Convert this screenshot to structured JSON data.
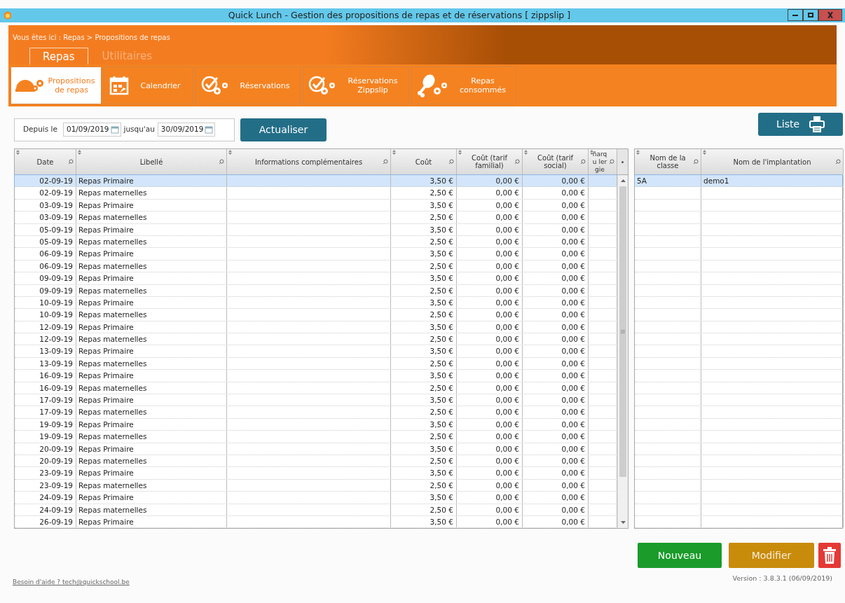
{
  "window": {
    "title": "Quick Lunch - Gestion des propositions de repas et de réservations [ zippslip ]"
  },
  "breadcrumb": "Vous êtes ici :  Repas > Propositions de repas",
  "tabs": [
    {
      "label": "Repas",
      "selected": true
    },
    {
      "label": "Utilitaires",
      "selected": false
    }
  ],
  "toolbar": [
    {
      "label": "Propositions de repas",
      "selected": true
    },
    {
      "label": "Calendrier",
      "selected": false
    },
    {
      "label": "Réservations",
      "selected": false
    },
    {
      "label": "Réservations Zippslip",
      "selected": false
    },
    {
      "label": "Repas consommés",
      "selected": false
    }
  ],
  "filter": {
    "from_label": "Depuis le",
    "from": "01/09/2019",
    "to_label": "jusqu'au",
    "to": "30/09/2019"
  },
  "refresh_button": "Actualiser",
  "list_button": "Liste",
  "meals_table": {
    "columns": [
      "Date",
      "Libellé",
      "Informations complémentaires",
      "Coût",
      "Coût (tarif familial)",
      "Coût (tarif social)",
      "ñarqu lergie"
    ],
    "rows": [
      {
        "date": "02-09-19",
        "label": "Repas Primaire",
        "cost": "3,50 €",
        "family": "0,00 €",
        "social": "0,00 €",
        "selected": true
      },
      {
        "date": "02-09-19",
        "label": "Repas maternelles",
        "cost": "2,50 €",
        "family": "0,00 €",
        "social": "0,00 €",
        "selected": false
      },
      {
        "date": "03-09-19",
        "label": "Repas Primaire",
        "cost": "3,50 €",
        "family": "0,00 €",
        "social": "0,00 €",
        "selected": false
      },
      {
        "date": "03-09-19",
        "label": "Repas maternelles",
        "cost": "2,50 €",
        "family": "0,00 €",
        "social": "0,00 €",
        "selected": false
      },
      {
        "date": "05-09-19",
        "label": "Repas Primaire",
        "cost": "3,50 €",
        "family": "0,00 €",
        "social": "0,00 €",
        "selected": false
      },
      {
        "date": "05-09-19",
        "label": "Repas maternelles",
        "cost": "2,50 €",
        "family": "0,00 €",
        "social": "0,00 €",
        "selected": false
      },
      {
        "date": "06-09-19",
        "label": "Repas Primaire",
        "cost": "3,50 €",
        "family": "0,00 €",
        "social": "0,00 €",
        "selected": false
      },
      {
        "date": "06-09-19",
        "label": "Repas maternelles",
        "cost": "2,50 €",
        "family": "0,00 €",
        "social": "0,00 €",
        "selected": false
      },
      {
        "date": "09-09-19",
        "label": "Repas Primaire",
        "cost": "3,50 €",
        "family": "0,00 €",
        "social": "0,00 €",
        "selected": false
      },
      {
        "date": "09-09-19",
        "label": "Repas maternelles",
        "cost": "2,50 €",
        "family": "0,00 €",
        "social": "0,00 €",
        "selected": false
      },
      {
        "date": "10-09-19",
        "label": "Repas Primaire",
        "cost": "3,50 €",
        "family": "0,00 €",
        "social": "0,00 €",
        "selected": false
      },
      {
        "date": "10-09-19",
        "label": "Repas maternelles",
        "cost": "2,50 €",
        "family": "0,00 €",
        "social": "0,00 €",
        "selected": false
      },
      {
        "date": "12-09-19",
        "label": "Repas Primaire",
        "cost": "3,50 €",
        "family": "0,00 €",
        "social": "0,00 €",
        "selected": false
      },
      {
        "date": "12-09-19",
        "label": "Repas maternelles",
        "cost": "2,50 €",
        "family": "0,00 €",
        "social": "0,00 €",
        "selected": false
      },
      {
        "date": "13-09-19",
        "label": "Repas Primaire",
        "cost": "3,50 €",
        "family": "0,00 €",
        "social": "0,00 €",
        "selected": false
      },
      {
        "date": "13-09-19",
        "label": "Repas maternelles",
        "cost": "2,50 €",
        "family": "0,00 €",
        "social": "0,00 €",
        "selected": false
      },
      {
        "date": "16-09-19",
        "label": "Repas Primaire",
        "cost": "3,50 €",
        "family": "0,00 €",
        "social": "0,00 €",
        "selected": false
      },
      {
        "date": "16-09-19",
        "label": "Repas maternelles",
        "cost": "2,50 €",
        "family": "0,00 €",
        "social": "0,00 €",
        "selected": false
      },
      {
        "date": "17-09-19",
        "label": "Repas Primaire",
        "cost": "3,50 €",
        "family": "0,00 €",
        "social": "0,00 €",
        "selected": false
      },
      {
        "date": "17-09-19",
        "label": "Repas maternelles",
        "cost": "2,50 €",
        "family": "0,00 €",
        "social": "0,00 €",
        "selected": false
      },
      {
        "date": "19-09-19",
        "label": "Repas Primaire",
        "cost": "3,50 €",
        "family": "0,00 €",
        "social": "0,00 €",
        "selected": false
      },
      {
        "date": "19-09-19",
        "label": "Repas maternelles",
        "cost": "2,50 €",
        "family": "0,00 €",
        "social": "0,00 €",
        "selected": false
      },
      {
        "date": "20-09-19",
        "label": "Repas Primaire",
        "cost": "3,50 €",
        "family": "0,00 €",
        "social": "0,00 €",
        "selected": false
      },
      {
        "date": "20-09-19",
        "label": "Repas maternelles",
        "cost": "2,50 €",
        "family": "0,00 €",
        "social": "0,00 €",
        "selected": false
      },
      {
        "date": "23-09-19",
        "label": "Repas Primaire",
        "cost": "3,50 €",
        "family": "0,00 €",
        "social": "0,00 €",
        "selected": false
      },
      {
        "date": "23-09-19",
        "label": "Repas maternelles",
        "cost": "2,50 €",
        "family": "0,00 €",
        "social": "0,00 €",
        "selected": false
      },
      {
        "date": "24-09-19",
        "label": "Repas Primaire",
        "cost": "3,50 €",
        "family": "0,00 €",
        "social": "0,00 €",
        "selected": false
      },
      {
        "date": "24-09-19",
        "label": "Repas maternelles",
        "cost": "2,50 €",
        "family": "0,00 €",
        "social": "0,00 €",
        "selected": false
      },
      {
        "date": "26-09-19",
        "label": "Repas Primaire",
        "cost": "3,50 €",
        "family": "0,00 €",
        "social": "0,00 €",
        "selected": false
      }
    ]
  },
  "classes_table": {
    "columns": [
      "Nom de la classe",
      "Nom de l'implantation"
    ],
    "rows": [
      {
        "class": "5A",
        "site": "demo1",
        "selected": true
      }
    ]
  },
  "actions": [
    {
      "label": "Nouveau",
      "kind": "new"
    },
    {
      "label": "Modifier",
      "kind": "edit"
    },
    {
      "kind": "delete"
    }
  ],
  "footer": {
    "help": "Besoin d'aide ? tech@quickschool.be",
    "version": "Version : 3.8.3.1 (06/09/2019)"
  }
}
